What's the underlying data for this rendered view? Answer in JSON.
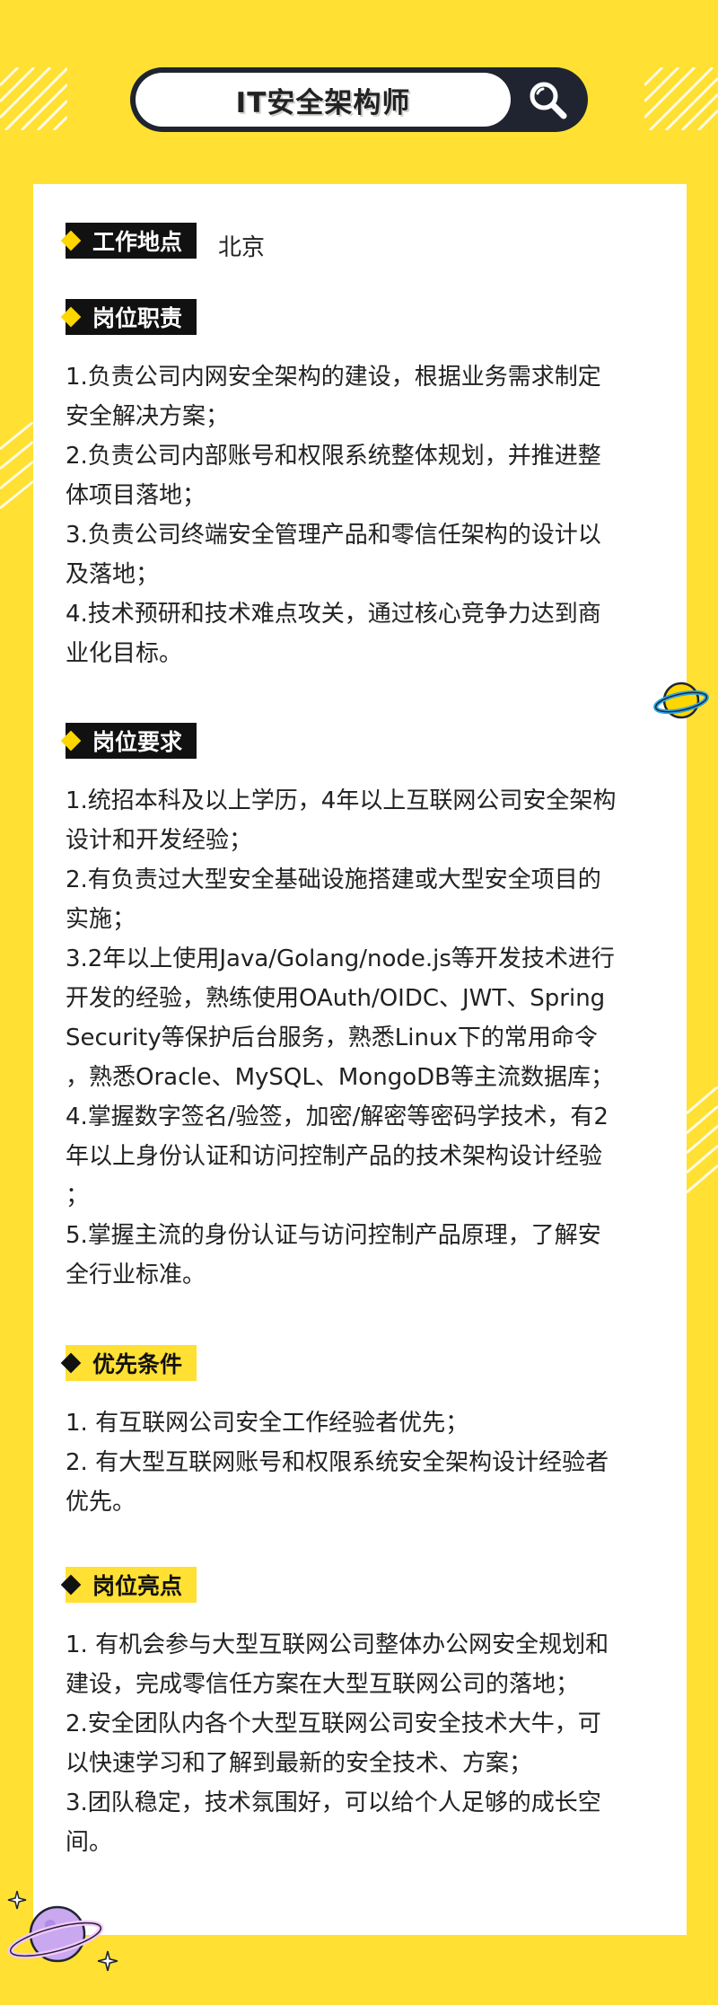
{
  "header": {
    "title": "IT安全架构师"
  },
  "location": {
    "label": "工作地点",
    "value": "北京"
  },
  "responsibilities": {
    "label": "岗位职责",
    "text": "1.负责公司内网安全架构的建设，根据业务需求制定\n安全解决方案；\n2.负责公司内部账号和权限系统整体规划，并推进整\n体项目落地；\n3.负责公司终端安全管理产品和零信任架构的设计以\n及落地；\n4.技术预研和技术难点攻关，通过核心竞争力达到商\n业化目标。"
  },
  "requirements": {
    "label": "岗位要求",
    "text": "1.统招本科及以上学历，4年以上互联网公司安全架构\n设计和开发经验；\n2.有负责过大型安全基础设施搭建或大型安全项目的\n实施；\n3.2年以上使用Java/Golang/node.js等开发技术进行\n开发的经验，熟练使用OAuth/OIDC、JWT、Spring\nSecurity等保护后台服务，熟悉Linux下的常用命令\n，熟悉Oracle、MySQL、MongoDB等主流数据库；\n4.掌握数字签名/验签，加密/解密等密码学技术，有2\n年以上身份认证和访问控制产品的技术架构设计经验\n；\n5.掌握主流的身份认证与访问控制产品原理，了解安\n全行业标准。"
  },
  "preferred": {
    "label": "优先条件",
    "text": "1. 有互联网公司安全工作经验者优先；\n2. 有大型互联网账号和权限系统安全架构设计经验者\n优先。"
  },
  "highlights": {
    "label": "岗位亮点",
    "text": "1. 有机会参与大型互联网公司整体办公网安全规划和\n建设，完成零信任方案在大型互联网公司的落地；\n2.安全团队内各个大型互联网公司安全技术大牛，可\n以快速学习和了解到最新的安全技术、方案；\n3.团队稳定，技术氛围好，可以给个人足够的成长空\n间。"
  },
  "colors": {
    "background": "#FFE033",
    "tag_dark": "#111111",
    "accent": "#FFD600",
    "text": "#222222"
  },
  "icons": [
    "search-icon",
    "planet-icon",
    "sparkle-icon",
    "stripe-decoration"
  ]
}
